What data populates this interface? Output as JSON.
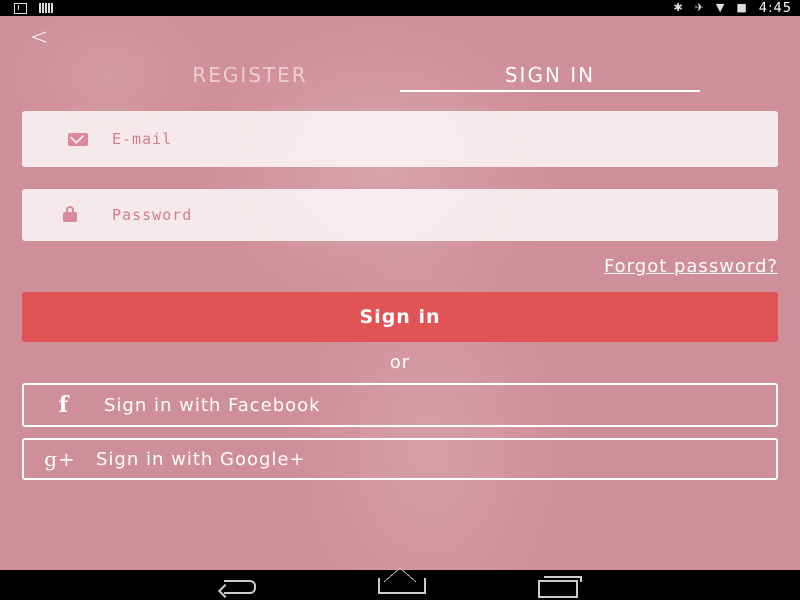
{
  "status_bar": {
    "time": "4:45",
    "icons": [
      "download-icon",
      "signal-bars-icon",
      "bluetooth-icon",
      "airplane-mode-icon",
      "wifi-icon",
      "battery-icon"
    ]
  },
  "tabs": [
    {
      "label": "REGISTER",
      "active": false
    },
    {
      "label": "SIGN IN",
      "active": true
    }
  ],
  "form": {
    "email_placeholder": "E-mail",
    "email_value": "",
    "password_placeholder": "Password",
    "password_value": "",
    "forgot_label": "Forgot password?",
    "signin_label": "Sign in",
    "or_label": "or",
    "facebook_label": "Sign in with Facebook",
    "google_label": "Sign in with Google+",
    "facebook_glyph": "f",
    "google_glyph": "g+"
  },
  "colors": {
    "background_tint": "#cf8f99",
    "primary_button": "#e25355",
    "field_bg": "#f3dde2"
  }
}
